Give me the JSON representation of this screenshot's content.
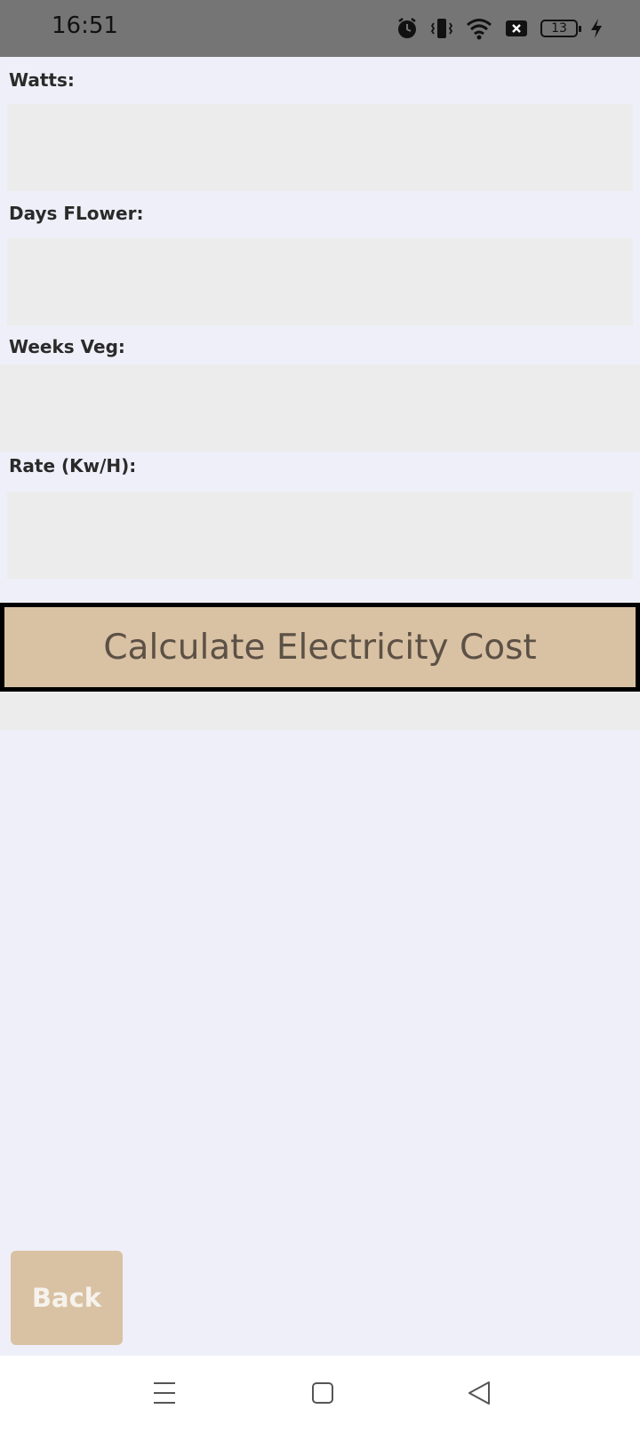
{
  "status_bar": {
    "time": "16:51",
    "battery_level": "13",
    "icons": [
      "alarm-icon",
      "vibrate-icon",
      "wifi-icon",
      "no-sim-icon",
      "battery-icon",
      "charging-icon"
    ]
  },
  "form": {
    "watts": {
      "label": "Watts:",
      "value": ""
    },
    "days_flower": {
      "label": "Days FLower:",
      "value": ""
    },
    "weeks_veg": {
      "label": "Weeks Veg:",
      "value": ""
    },
    "rate": {
      "label": "Rate (Kw/H):",
      "value": ""
    }
  },
  "actions": {
    "calculate_label": "Calculate Electricity Cost",
    "result": "",
    "back_label": "Back"
  },
  "nav_bar": {
    "buttons": [
      "menu-icon",
      "home-icon",
      "back-triangle-icon"
    ]
  },
  "colors": {
    "background": "#efeff9",
    "input_fill": "#ececec",
    "button_fill": "#d9c1a3",
    "button_text": "#5c5146",
    "status_bar": "#757575"
  }
}
